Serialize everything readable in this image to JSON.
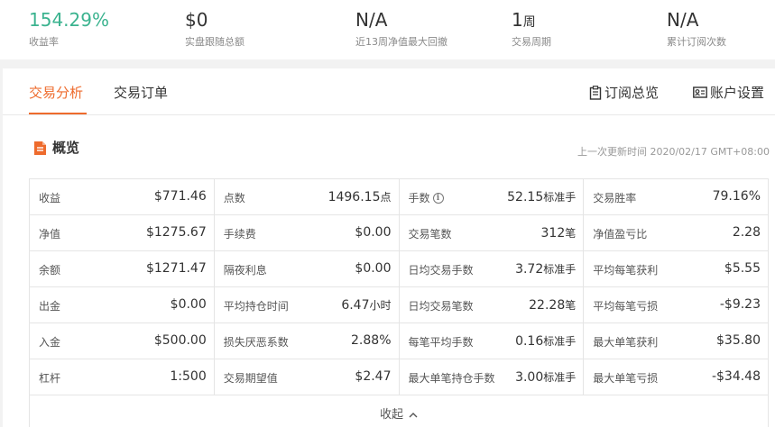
{
  "stats": [
    {
      "value": "154.29%",
      "unit": "",
      "label": "收益率"
    },
    {
      "value": "$0",
      "unit": "",
      "label": "实盘跟随总额"
    },
    {
      "value": "N/A",
      "unit": "",
      "label": "近13周净值最大回撤"
    },
    {
      "value": "1",
      "unit": "周",
      "label": "交易周期"
    },
    {
      "value": "N/A",
      "unit": "",
      "label": "累计订阅次数"
    }
  ],
  "colors": {
    "accent": "#ee6b2d",
    "positive": "#3bb38f"
  },
  "tabs": [
    {
      "label": "交易分析",
      "active": true
    },
    {
      "label": "交易订单",
      "active": false
    }
  ],
  "actions": {
    "subscription_overview": "订阅总览",
    "account_settings": "账户设置"
  },
  "overview": {
    "title": "概览",
    "updated": "上一次更新时间 2020/02/17 GMT+08:00",
    "collapse_label": "收起",
    "rows": [
      [
        {
          "label": "收益",
          "value": "$771.46",
          "unit": ""
        },
        {
          "label": "点数",
          "value": "1496.15",
          "unit": "点"
        },
        {
          "label": "手数",
          "value": "52.15",
          "unit": "标准手",
          "info": true
        },
        {
          "label": "交易胜率",
          "value": "79.16%",
          "unit": ""
        }
      ],
      [
        {
          "label": "净值",
          "value": "$1275.67",
          "unit": ""
        },
        {
          "label": "手续费",
          "value": "$0.00",
          "unit": ""
        },
        {
          "label": "交易笔数",
          "value": "312",
          "unit": "笔"
        },
        {
          "label": "净值盈亏比",
          "value": "2.28",
          "unit": ""
        }
      ],
      [
        {
          "label": "余额",
          "value": "$1271.47",
          "unit": ""
        },
        {
          "label": "隔夜利息",
          "value": "$0.00",
          "unit": ""
        },
        {
          "label": "日均交易手数",
          "value": "3.72",
          "unit": "标准手"
        },
        {
          "label": "平均每笔获利",
          "value": "$5.55",
          "unit": ""
        }
      ],
      [
        {
          "label": "出金",
          "value": "$0.00",
          "unit": ""
        },
        {
          "label": "平均持仓时间",
          "value": "6.47",
          "unit": "小时"
        },
        {
          "label": "日均交易笔数",
          "value": "22.28",
          "unit": "笔"
        },
        {
          "label": "平均每笔亏损",
          "value": "-$9.23",
          "unit": ""
        }
      ],
      [
        {
          "label": "入金",
          "value": "$500.00",
          "unit": ""
        },
        {
          "label": "损失厌恶系数",
          "value": "2.88%",
          "unit": ""
        },
        {
          "label": "每笔平均手数",
          "value": "0.16",
          "unit": "标准手"
        },
        {
          "label": "最大单笔获利",
          "value": "$35.80",
          "unit": ""
        }
      ],
      [
        {
          "label": "杠杆",
          "value": "1:500",
          "unit": ""
        },
        {
          "label": "交易期望值",
          "value": "$2.47",
          "unit": ""
        },
        {
          "label": "最大单笔持仓手数",
          "value": "3.00",
          "unit": "标准手"
        },
        {
          "label": "最大单笔亏损",
          "value": "-$34.48",
          "unit": ""
        }
      ]
    ]
  }
}
